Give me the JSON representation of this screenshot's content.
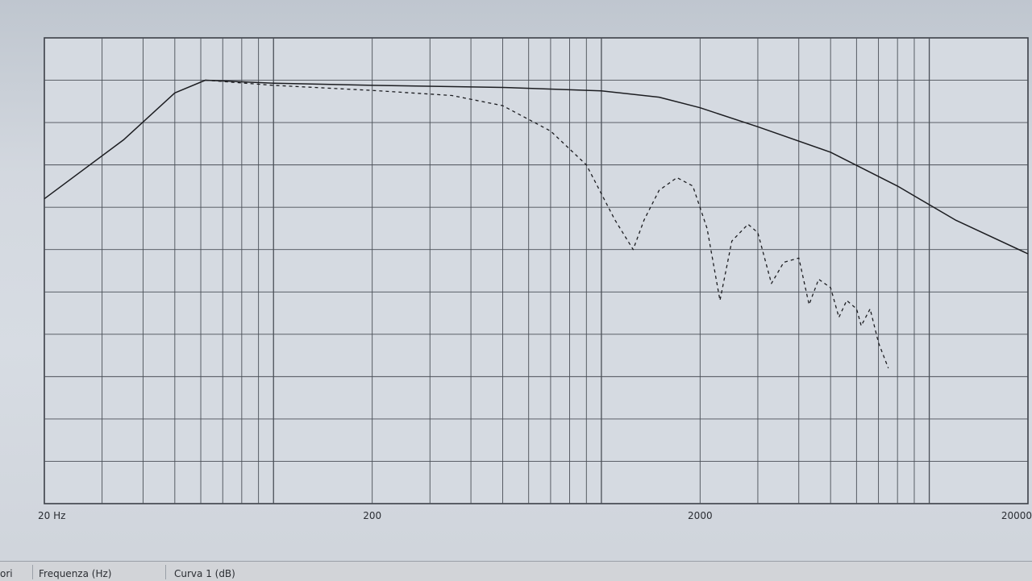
{
  "chart_data": {
    "type": "line",
    "x_scale": "log",
    "x_range": [
      20,
      20000
    ],
    "ylim": [
      -100,
      10
    ],
    "y_gridlines": [
      10,
      0,
      -10,
      -20,
      -30,
      -40,
      -50,
      -60,
      -70,
      -80,
      -90,
      -100
    ],
    "grid": true,
    "x_tick_labels": [
      "20 Hz",
      "200",
      "2000",
      "20000"
    ],
    "x_tick_values": [
      20,
      200,
      2000,
      20000
    ],
    "series": [
      {
        "style": "solid",
        "x": [
          20,
          35,
          50,
          62,
          100,
          200,
          500,
          1000,
          1500,
          2000,
          3000,
          5000,
          8000,
          12000,
          20000
        ],
        "y": [
          -28,
          -14,
          -3,
          0,
          -0.7,
          -1.2,
          -1.7,
          -2.5,
          -4,
          -6.5,
          -11,
          -17,
          -25,
          -33,
          -41
        ]
      },
      {
        "style": "dashed",
        "x": [
          62,
          100,
          200,
          350,
          500,
          700,
          900,
          1100,
          1250,
          1350,
          1500,
          1700,
          1900,
          2100,
          2300,
          2500,
          2800,
          3000,
          3300,
          3600,
          4000,
          4300,
          4600,
          5000,
          5300,
          5600,
          6000,
          6200,
          6600,
          7000,
          7500
        ],
        "y": [
          0,
          -1.2,
          -2.4,
          -3.6,
          -6,
          -12,
          -20,
          -33,
          -40,
          -33,
          -26,
          -23,
          -25,
          -35,
          -52,
          -38,
          -34,
          -36,
          -48,
          -43,
          -42,
          -53,
          -47,
          -49,
          -56,
          -52,
          -54,
          -58,
          -54,
          -62,
          -68
        ]
      }
    ]
  },
  "status_bar": {
    "left_fragment": "ori",
    "x_label": "Frequenza (Hz)",
    "curve_label": "Curva 1 (dB)"
  },
  "colors": {
    "grid": "#4a4f57",
    "curve": "#1c1d21",
    "plot_bg": "#d4d9e0"
  }
}
